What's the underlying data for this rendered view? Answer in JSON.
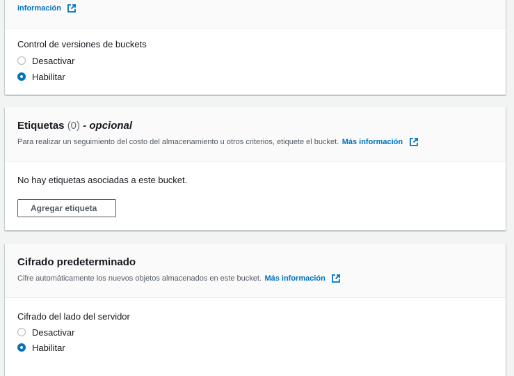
{
  "top_panel": {
    "more_info_link": "información"
  },
  "versioning_panel": {
    "label": "Control de versiones de buckets",
    "options": [
      {
        "label": "Desactivar",
        "checked": false
      },
      {
        "label": "Habilitar",
        "checked": true
      }
    ]
  },
  "tags_panel": {
    "title": "Etiquetas",
    "count": "(0)",
    "optional": "- opcional",
    "description": "Para realizar un seguimiento del costo del almacenamiento u otros criterios, etiquete el bucket.",
    "more_info_link": "Más información",
    "empty_message": "No hay etiquetas asociadas a este bucket.",
    "add_button": "Agregar etiqueta"
  },
  "encryption_panel": {
    "title": "Cifrado predeterminado",
    "description": "Cifre automáticamente los nuevos objetos almacenados en este bucket.",
    "more_info_link": "Más información",
    "label": "Cifrado del lado del servidor",
    "options": [
      {
        "label": "Desactivar",
        "checked": false
      },
      {
        "label": "Habilitar",
        "checked": true
      }
    ]
  },
  "colors": {
    "link": "#0073bb",
    "radio_selected": "#0073bb",
    "background": "#f2f3f3"
  }
}
